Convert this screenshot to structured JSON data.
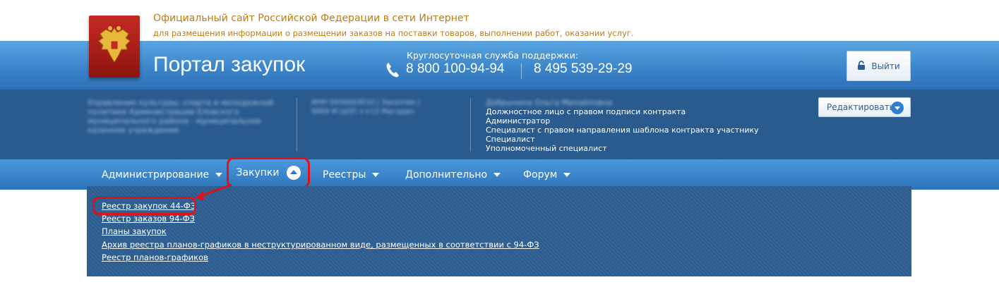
{
  "site": {
    "official_title": "Официальный сайт Российской Федерации в сети Интернет",
    "official_subtitle": "для размещения информации о размещении заказов на поставки товаров, выполнении работ, оказании услуг.",
    "portal_title": "Портал закупок",
    "emblem": "russian-eagle-emblem"
  },
  "support": {
    "label": "Круглосуточная служба поддержки:",
    "phone1": "8 800 100-94-94",
    "phone2": "8 495 539-29-29",
    "icon": "phone-icon"
  },
  "header": {
    "logout_label": "Выйти",
    "logout_icon": "lock-icon"
  },
  "org": {
    "name": "Управление культуры, спорта и молодежной политики Администрации Еловского муниципального района - муниципальное казенное учреждение",
    "info": "ИНН 5930003010 | Заказчик | 9969 М ЦОП ++12 Магадан",
    "user_name": "Добрынина Ольга Михайловна",
    "roles": [
      "Должностное лицо с правом подписи контракта",
      "Администратор",
      "Специалист с правом направления шаблона контракта участнику",
      "Специалист",
      "Уполномоченный специалист"
    ],
    "edit_label": "Редактировать"
  },
  "nav": {
    "items": [
      {
        "label": "Администрирование"
      },
      {
        "label": "Закупки"
      },
      {
        "label": "Реестры"
      },
      {
        "label": "Дополнительно"
      },
      {
        "label": "Форум"
      }
    ]
  },
  "dropdown": {
    "links": [
      "Реестр закупок 44-ФЗ",
      "Реестр заказов 94-ФЗ",
      "Планы закупок",
      "Архив реестра планов-графиков в неструктурированном виде, размещенных в соответствии с 94-ФЗ",
      "Реестр планов-графиков"
    ]
  },
  "colors": {
    "header_blue": "#3c86cc",
    "org_band": "#2a5b8f",
    "dropdown_bg": "#2d5f93",
    "highlight_red": "#e2101a",
    "official_text": "#c07a10"
  }
}
